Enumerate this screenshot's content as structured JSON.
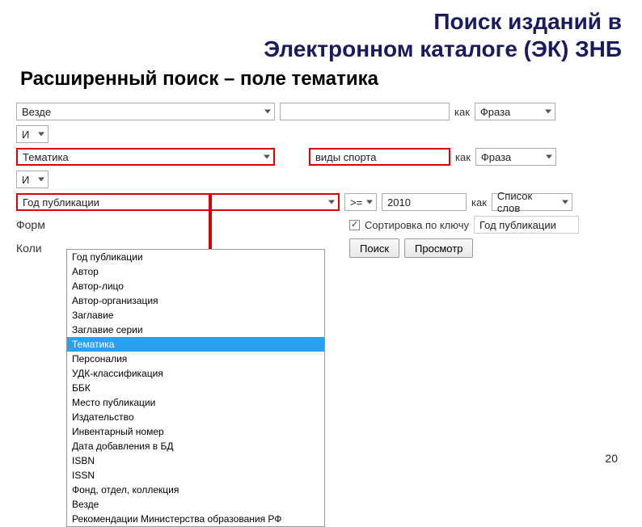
{
  "title_line1": "Поиск изданий в",
  "title_line2": "Электронном каталоге (ЭК) ЗНБ",
  "subtitle": "Расширенный поиск – поле тематика",
  "as_label": "как",
  "row1": {
    "field": "Везде",
    "value": "",
    "mode": "Фраза"
  },
  "op1": "И",
  "row2": {
    "field": "Тематика",
    "value": "виды спорта",
    "mode": "Фраза"
  },
  "op2": "И",
  "row3": {
    "field": "Год публикации",
    "cmp": ">=",
    "value": "2010",
    "mode": "Список слов"
  },
  "format_label": "Форм",
  "count_label": "Коли",
  "sort_label": "Сортировка по ключу",
  "sort_value": "Год публикации",
  "btn_search": "Поиск",
  "btn_preview": "Просмотр",
  "dropdown_options": [
    "Год публикации",
    "Автор",
    "Автор-лицо",
    "Автор-организация",
    "Заглавие",
    "Заглавие серии",
    "Тематика",
    "Персоналия",
    "УДК-классификация",
    "ББК",
    "Место публикации",
    "Издательство",
    "Инвентарный номер",
    "Дата добавления в БД",
    "ISBN",
    "ISSN",
    "Фонд, отдел, коллекция",
    "Везде",
    "Рекомендации Министерства образования РФ"
  ],
  "dropdown_selected_index": 6,
  "page_number": "20"
}
